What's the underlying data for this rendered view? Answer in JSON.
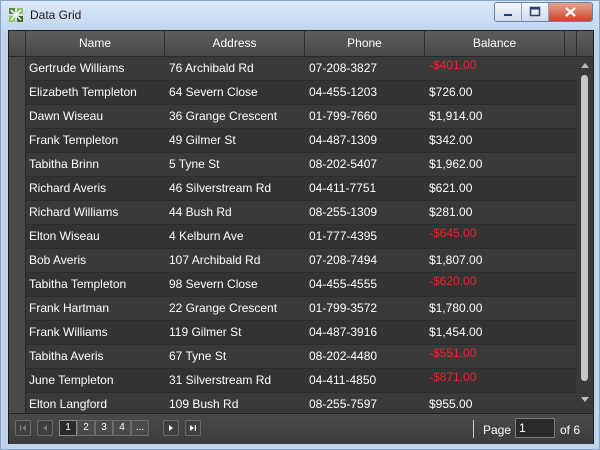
{
  "window": {
    "title": "Data Grid"
  },
  "grid": {
    "columns": [
      "Name",
      "Address",
      "Phone",
      "Balance"
    ],
    "rows": [
      {
        "name": "Gertrude Williams",
        "address": "76 Archibald Rd",
        "phone": "07-208-3827",
        "balance": "-$401.00",
        "negative": true
      },
      {
        "name": "Elizabeth Templeton",
        "address": "64 Severn Close",
        "phone": "04-455-1203",
        "balance": "$726.00",
        "negative": false
      },
      {
        "name": "Dawn Wiseau",
        "address": "36 Grange Crescent",
        "phone": "01-799-7660",
        "balance": "$1,914.00",
        "negative": false
      },
      {
        "name": "Frank Templeton",
        "address": "49 Gilmer St",
        "phone": "04-487-1309",
        "balance": "$342.00",
        "negative": false
      },
      {
        "name": "Tabitha Brinn",
        "address": "5 Tyne St",
        "phone": "08-202-5407",
        "balance": "$1,962.00",
        "negative": false
      },
      {
        "name": "Richard Averis",
        "address": "46 Silverstream Rd",
        "phone": "04-411-7751",
        "balance": "$621.00",
        "negative": false
      },
      {
        "name": "Richard Williams",
        "address": "44 Bush Rd",
        "phone": "08-255-1309",
        "balance": "$281.00",
        "negative": false
      },
      {
        "name": "Elton Wiseau",
        "address": "4 Kelburn Ave",
        "phone": "01-777-4395",
        "balance": "-$645.00",
        "negative": true
      },
      {
        "name": "Bob Averis",
        "address": "107 Archibald Rd",
        "phone": "07-208-7494",
        "balance": "$1,807.00",
        "negative": false
      },
      {
        "name": "Tabitha Templeton",
        "address": "98 Severn Close",
        "phone": "04-455-4555",
        "balance": "-$620.00",
        "negative": true
      },
      {
        "name": "Frank Hartman",
        "address": "22 Grange Crescent",
        "phone": "01-799-3572",
        "balance": "$1,780.00",
        "negative": false
      },
      {
        "name": "Frank Williams",
        "address": "119 Gilmer St",
        "phone": "04-487-3916",
        "balance": "$1,454.00",
        "negative": false
      },
      {
        "name": "Tabitha Averis",
        "address": "67 Tyne St",
        "phone": "08-202-4480",
        "balance": "-$551.00",
        "negative": true
      },
      {
        "name": "June Templeton",
        "address": "31 Silverstream Rd",
        "phone": "04-411-4850",
        "balance": "-$871.00",
        "negative": true
      },
      {
        "name": "Elton Langford",
        "address": "109 Bush Rd",
        "phone": "08-255-7597",
        "balance": "$955.00",
        "negative": false
      }
    ]
  },
  "pager": {
    "pages": [
      "1",
      "2",
      "3",
      "4",
      "..."
    ],
    "current_page": 1,
    "page_label": "Page",
    "page_value": "1",
    "of_label": "of 6"
  },
  "colors": {
    "negative": "#e22a2a",
    "grid_bg": "#3a3a3a"
  },
  "icons": [
    "app-grid-icon",
    "minimize-icon",
    "maximize-icon",
    "close-icon",
    "first-page-icon",
    "prev-page-icon",
    "next-page-icon",
    "last-page-icon"
  ]
}
